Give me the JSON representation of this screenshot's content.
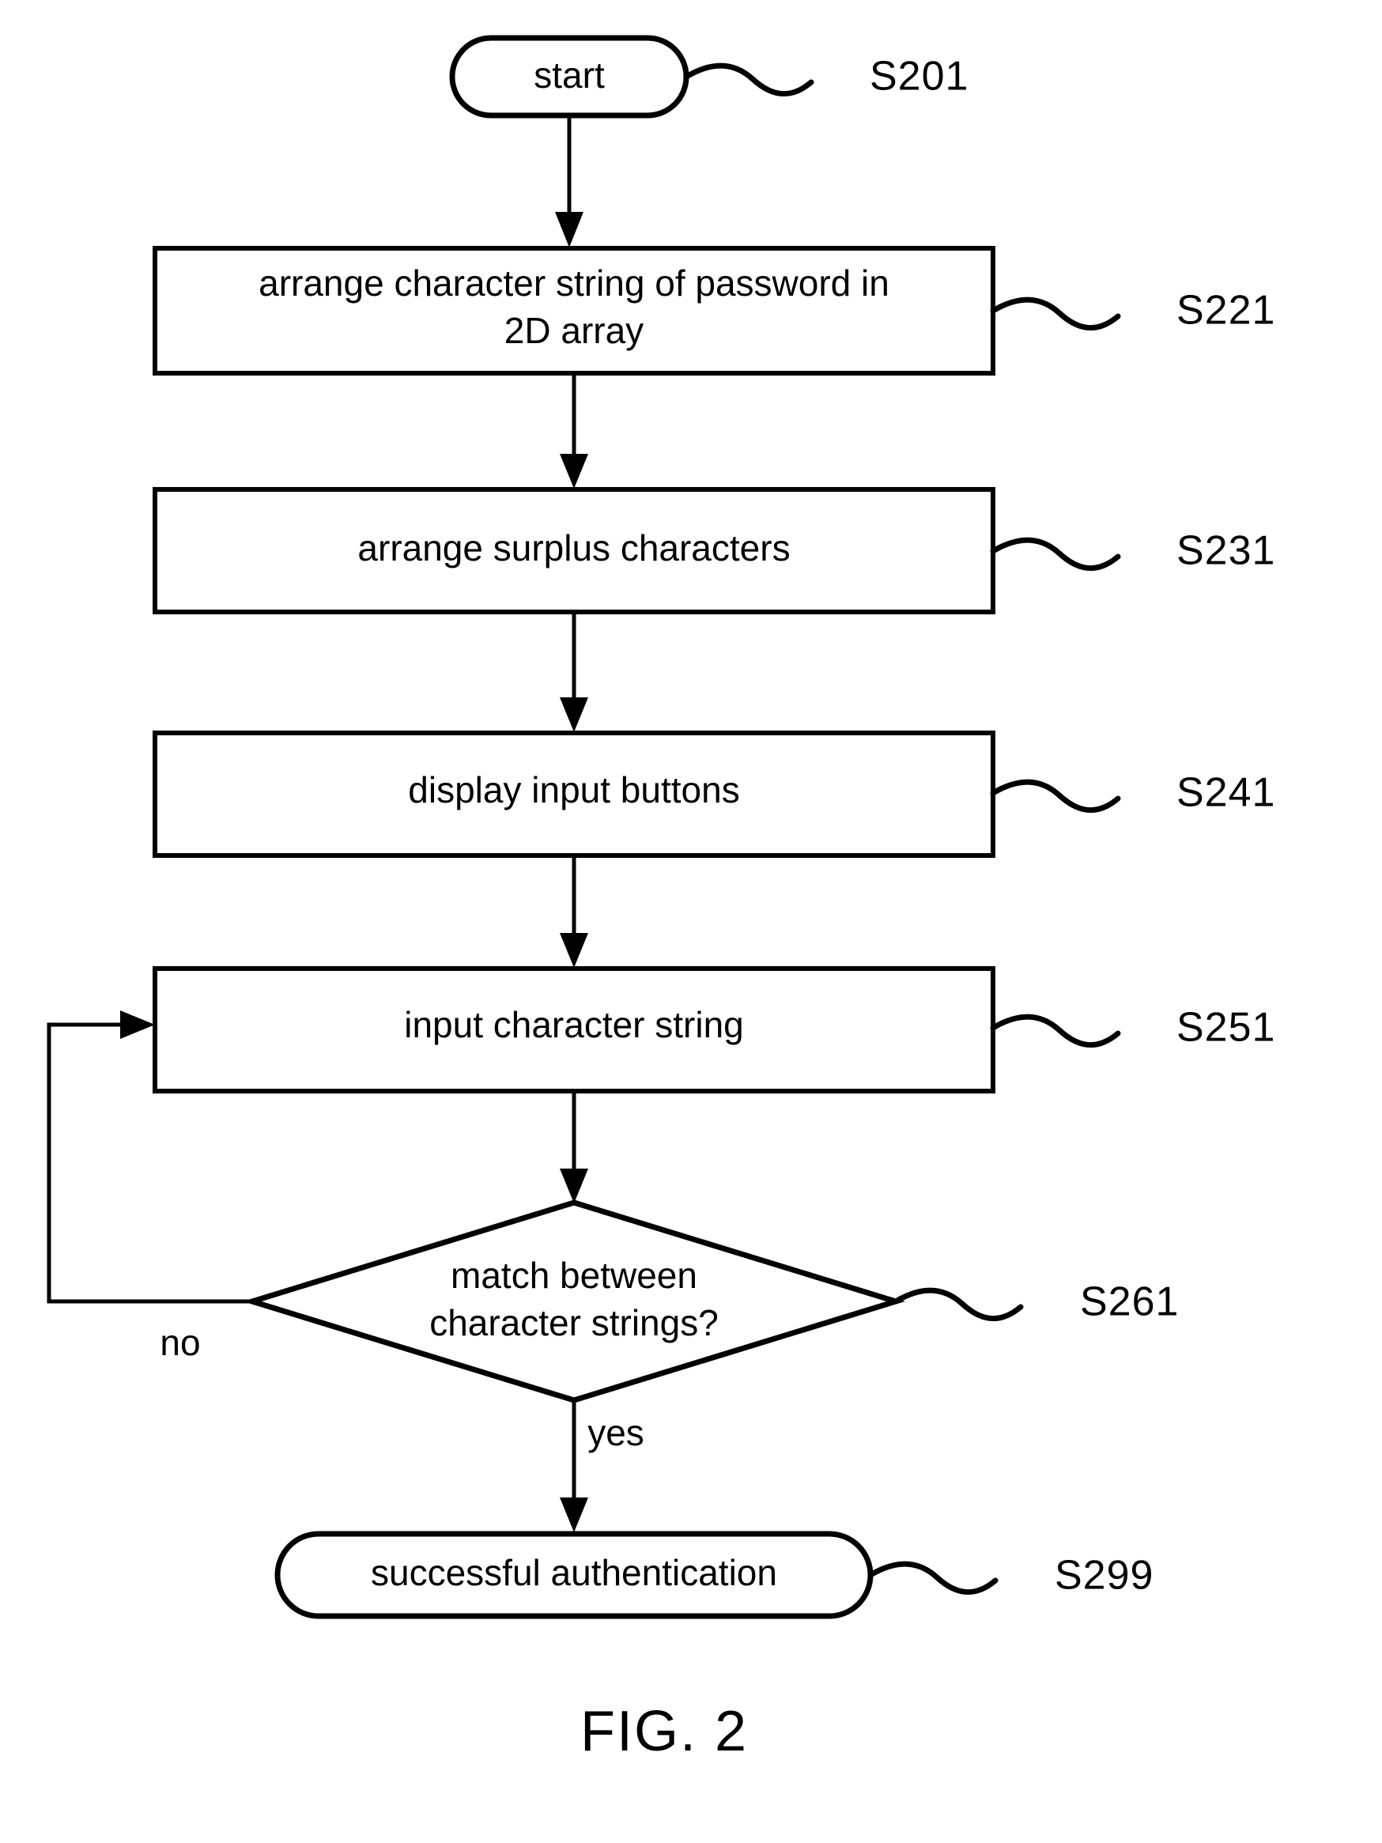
{
  "figure": {
    "caption": "FIG. 2",
    "type": "flowchart",
    "orientation": "top-to-bottom"
  },
  "nodes": [
    {
      "id": "start",
      "shape": "terminal",
      "label": "start",
      "step_label": "S201"
    },
    {
      "id": "arrange-password",
      "shape": "process",
      "label_line1": "arrange character string of password in",
      "label_line2": "2D array",
      "step_label": "S221"
    },
    {
      "id": "arrange-surplus",
      "shape": "process",
      "label": "arrange surplus characters",
      "step_label": "S231"
    },
    {
      "id": "display-buttons",
      "shape": "process",
      "label": "display input buttons",
      "step_label": "S241"
    },
    {
      "id": "input-string",
      "shape": "process",
      "label": "input character string",
      "step_label": "S251"
    },
    {
      "id": "match-decision",
      "shape": "decision",
      "label_line1": "match between",
      "label_line2": "character strings?",
      "step_label": "S261"
    },
    {
      "id": "success",
      "shape": "terminal",
      "label": "successful authentication",
      "step_label": "S299"
    }
  ],
  "branch_labels": {
    "no": "no",
    "yes": "yes"
  },
  "colors": {
    "stroke": "#000000",
    "fill": "#ffffff",
    "background": "#ffffff"
  }
}
